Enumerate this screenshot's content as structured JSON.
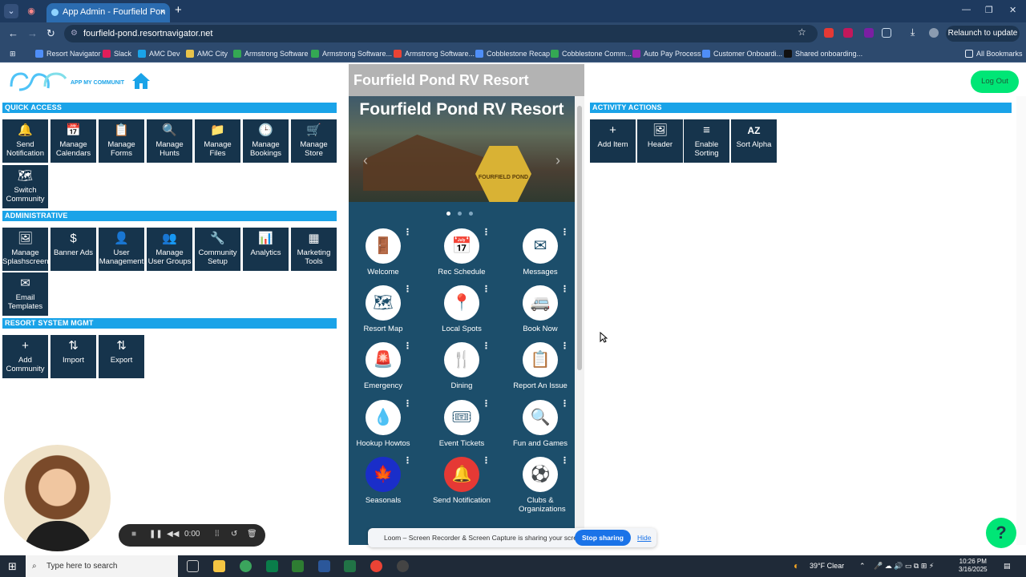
{
  "browser": {
    "tab_title": "App Admin - Fourfield Pon",
    "url": "fourfield-pond.resortnavigator.net",
    "relaunch_label": "Relaunch to update",
    "bookmarks": [
      {
        "label": "Resort Navigator",
        "color": "#4f8ef7"
      },
      {
        "label": "Slack",
        "color": "#e01e5a"
      },
      {
        "label": "AMC Dev",
        "color": "#1aa3e8"
      },
      {
        "label": "AMC City",
        "color": "#e8c34a"
      },
      {
        "label": "Armstrong Software",
        "color": "#34a853"
      },
      {
        "label": "Armstrong Software...",
        "color": "#34a853"
      },
      {
        "label": "Armstrong Software...",
        "color": "#ea4335"
      },
      {
        "label": "Cobblestone Recap",
        "color": "#4f8ef7"
      },
      {
        "label": "Cobblestone Comm...",
        "color": "#34a853"
      },
      {
        "label": "Auto Pay Process",
        "color": "#9c27b0"
      },
      {
        "label": "Customer Onboardi...",
        "color": "#4f8ef7"
      },
      {
        "label": "Shared onboarding...",
        "color": "#111111"
      }
    ],
    "all_bookmarks": "All Bookmarks"
  },
  "sections": {
    "quick_access": "QUICK ACCESS",
    "administrative": "ADMINISTRATIVE",
    "resort_system": "RESORT SYSTEM MGMT",
    "activity_actions": "ACTIVITY ACTIONS"
  },
  "quick_access": [
    {
      "label": "Send Notification",
      "icon": "bell-icon",
      "glyph": "🔔"
    },
    {
      "label": "Manage Calendars",
      "icon": "calendar-icon",
      "glyph": "📅"
    },
    {
      "label": "Manage Forms",
      "icon": "form-icon",
      "glyph": "📋"
    },
    {
      "label": "Manage Hunts",
      "icon": "search-icon",
      "glyph": "🔍"
    },
    {
      "label": "Manage Files",
      "icon": "folder-icon",
      "glyph": "📁"
    },
    {
      "label": "Manage Bookings",
      "icon": "clock-icon",
      "glyph": "🕒"
    },
    {
      "label": "Manage Store",
      "icon": "cart-icon",
      "glyph": "🛒"
    },
    {
      "label": "Switch Community",
      "icon": "map-icon",
      "glyph": "🗺"
    }
  ],
  "administrative": [
    {
      "label": "Manage Splashscreen",
      "icon": "image-icon",
      "glyph": "🖼"
    },
    {
      "label": "Banner Ads",
      "icon": "dollar-icon",
      "glyph": "$"
    },
    {
      "label": "User Management",
      "icon": "user-icon",
      "glyph": "👤"
    },
    {
      "label": "Manage User Groups",
      "icon": "users-icon",
      "glyph": "👥"
    },
    {
      "label": "Community Setup",
      "icon": "wrench-icon",
      "glyph": "🔧"
    },
    {
      "label": "Analytics",
      "icon": "chart-icon",
      "glyph": "📊"
    },
    {
      "label": "Marketing Tools",
      "icon": "grid-icon",
      "glyph": "▦"
    },
    {
      "label": "Email Templates",
      "icon": "mail-icon",
      "glyph": "✉"
    }
  ],
  "resort_system": [
    {
      "label": "Add Community",
      "icon": "plus-icon",
      "glyph": "+"
    },
    {
      "label": "Import",
      "icon": "swap-icon",
      "glyph": "⇅"
    },
    {
      "label": "Export",
      "icon": "swap-icon",
      "glyph": "⇅"
    }
  ],
  "activity_actions": [
    {
      "label": "Add Item",
      "icon": "plus-icon",
      "glyph": "+"
    },
    {
      "label": "Header",
      "icon": "image-icon",
      "glyph": "🖼"
    },
    {
      "label": "Enable Sorting",
      "icon": "sort-icon",
      "glyph": "≡"
    },
    {
      "label": "Sort Alpha",
      "icon": "sort-alpha-icon",
      "glyph": "AZ"
    }
  ],
  "preview": {
    "header_title": "Fourfield Pond RV Resort",
    "hero_title": "Fourfield Pond RV Resort",
    "badge_text": "FOURFIELD POND",
    "items": [
      {
        "label": "Welcome",
        "icon": "door-icon",
        "glyph": "🚪",
        "bg": "#ffffff",
        "fg": "#1c4e6b"
      },
      {
        "label": "Rec Schedule",
        "icon": "calendar-icon",
        "glyph": "📅",
        "bg": "#ffffff",
        "fg": "#1c4e6b"
      },
      {
        "label": "Messages",
        "icon": "mail-icon",
        "glyph": "✉",
        "bg": "#ffffff",
        "fg": "#1c4e6b"
      },
      {
        "label": "Resort Map",
        "icon": "map-icon",
        "glyph": "🗺",
        "bg": "#ffffff",
        "fg": "#1c4e6b"
      },
      {
        "label": "Local Spots",
        "icon": "pin-icon",
        "glyph": "📍",
        "bg": "#ffffff",
        "fg": "#1c4e6b"
      },
      {
        "label": "Book Now",
        "icon": "rv-icon",
        "glyph": "🚐",
        "bg": "#ffffff",
        "fg": "#1c4e6b"
      },
      {
        "label": "Emergency",
        "icon": "siren-icon",
        "glyph": "🚨",
        "bg": "#ffffff",
        "fg": "#d32f2f"
      },
      {
        "label": "Dining",
        "icon": "utensils-icon",
        "glyph": "🍴",
        "bg": "#ffffff",
        "fg": "#1c4e6b"
      },
      {
        "label": "Report An Issue",
        "icon": "clipboard-icon",
        "glyph": "📋",
        "bg": "#ffffff",
        "fg": "#1c4e6b"
      },
      {
        "label": "Hookup Howtos",
        "icon": "water-drop-icon",
        "glyph": "💧",
        "bg": "#ffffff",
        "fg": "#1c4e6b"
      },
      {
        "label": "Event Tickets",
        "icon": "ticket-icon",
        "glyph": "🎟",
        "bg": "#ffffff",
        "fg": "#1c4e6b"
      },
      {
        "label": "Fun and Games",
        "icon": "search-icon",
        "glyph": "🔍",
        "bg": "#ffffff",
        "fg": "#1c4e6b"
      },
      {
        "label": "Seasonals",
        "icon": "leaf-icon",
        "glyph": "🍁",
        "bg": "#1a2ec9",
        "fg": "#ffffff"
      },
      {
        "label": "Send Notification",
        "icon": "bell-icon",
        "glyph": "🔔",
        "bg": "#e53935",
        "fg": "#ffd600"
      },
      {
        "label": "Clubs & Organizations",
        "icon": "ball-icon",
        "glyph": "⚽",
        "bg": "#ffffff",
        "fg": "#1c4e6b"
      }
    ]
  },
  "header": {
    "logout": "Log Out"
  },
  "recorder": {
    "time": "0:00"
  },
  "loom": {
    "message": "Loom – Screen Recorder & Screen Capture is sharing your screen.",
    "stop": "Stop sharing",
    "hide": "Hide"
  },
  "help": "?",
  "taskbar": {
    "search_placeholder": "Type here to search",
    "weather": "39°F  Clear",
    "time": "10:26 PM",
    "date": "3/16/2025"
  },
  "colors": {
    "section": "#1aa3e8",
    "tile": "#16344c",
    "accent": "#00e676",
    "phone": "#1c4e6b"
  }
}
